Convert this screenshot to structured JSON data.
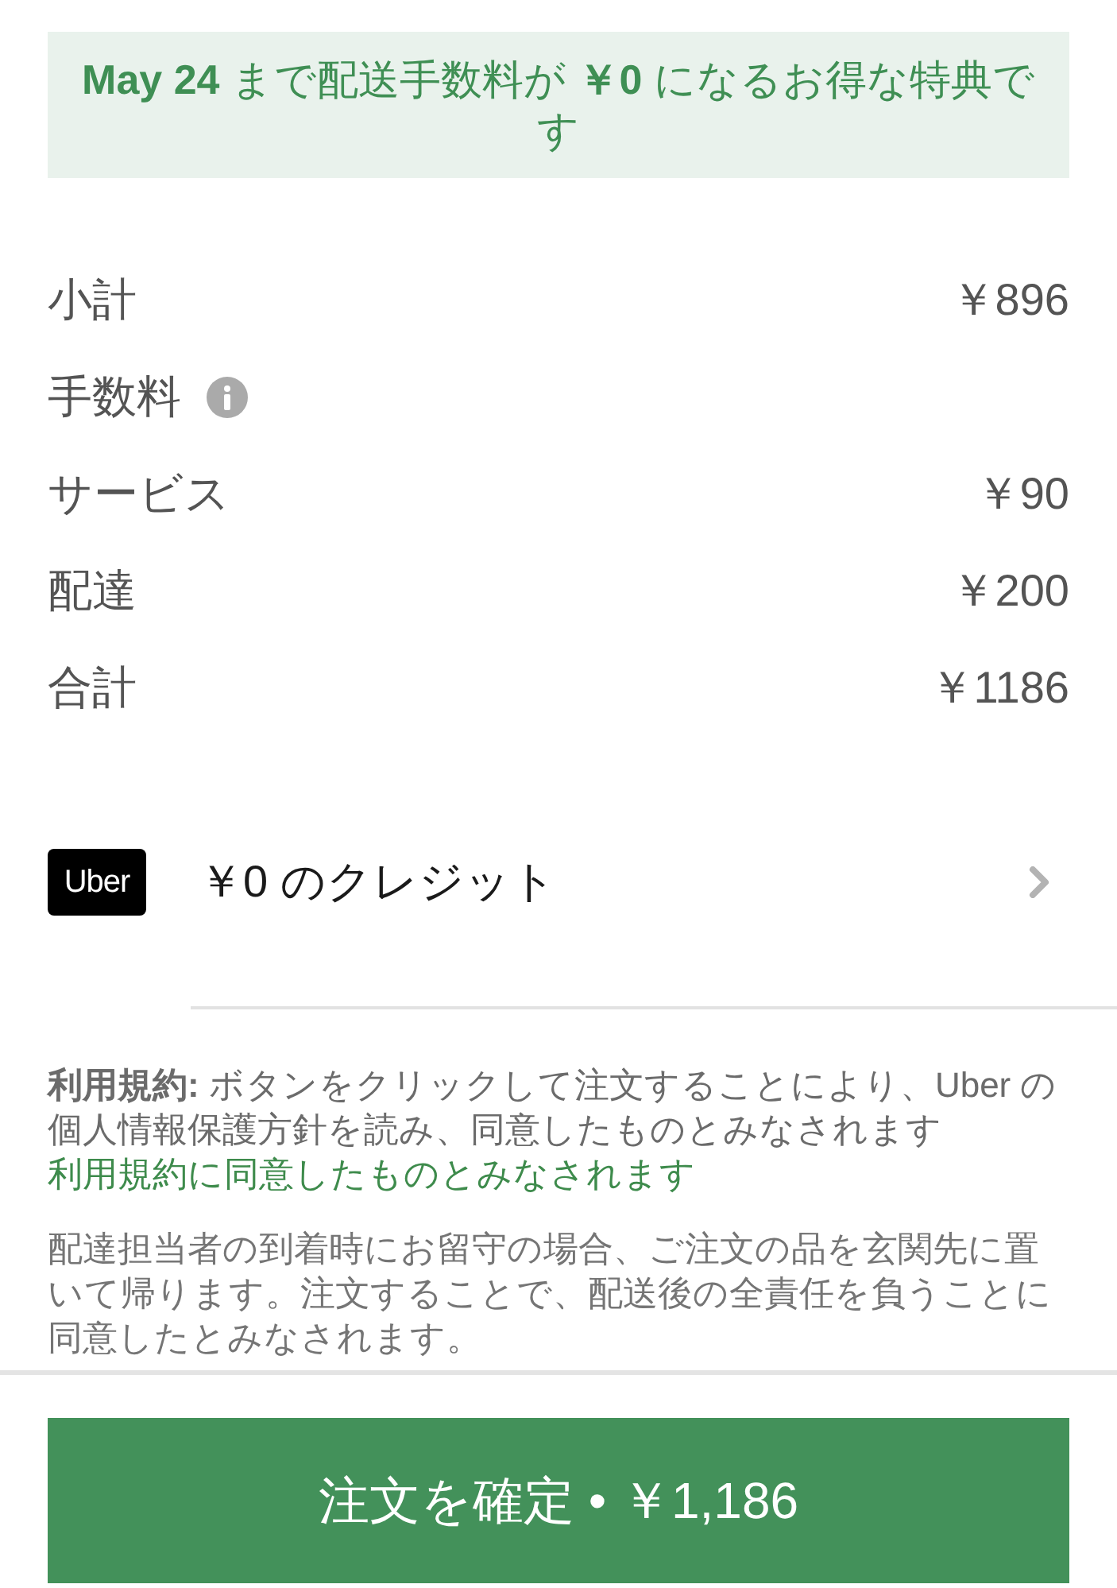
{
  "promo_banner": {
    "text": "**May 24** まで配送手数料が **￥0** になるお得な特典です"
  },
  "fees": [
    {
      "kind": "amount",
      "label": "小計",
      "value": "￥896"
    },
    {
      "kind": "info",
      "label": "手数料"
    },
    {
      "kind": "amount",
      "label": "サービス",
      "value": "￥90"
    },
    {
      "kind": "amount",
      "label": "配達",
      "value": "￥200"
    },
    {
      "kind": "amount",
      "label": "合計",
      "value": "￥1186"
    }
  ],
  "credit": {
    "logo": "Uber",
    "label": "￥0 のクレジット"
  },
  "terms": {
    "text": "**利用規約:** ボタンをクリックして注文することにより、Uber の個人情報保護方針を読み、同意したものとみなされます",
    "link": "利用規約に同意したものとみなされます"
  },
  "delivery_note": "配達担当者の到着時にお留守の場合、ご注文の品を玄関先に置いて帰ります。注文することで、配送後の全責任を負うことに同意したとみなされます。",
  "confirm_button": {
    "label": "注文を確定 • ￥1,186"
  }
}
